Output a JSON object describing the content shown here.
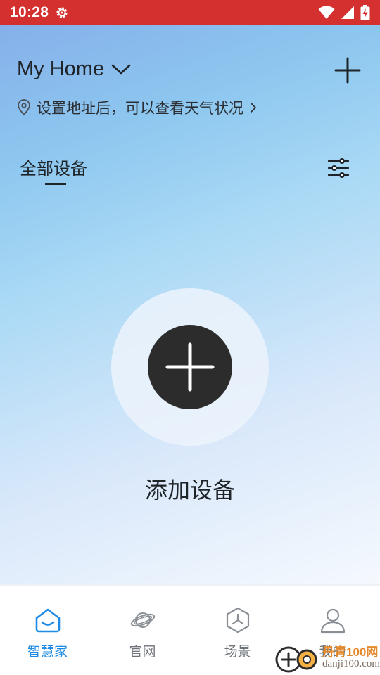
{
  "status_bar": {
    "time": "10:28"
  },
  "header": {
    "home_name": "My Home",
    "location_text": "设置地址后，可以查看天气状况"
  },
  "tabs": {
    "all_devices": "全部设备"
  },
  "main": {
    "add_device_label": "添加设备"
  },
  "bottom_nav": {
    "items": [
      {
        "label": "智慧家",
        "icon": "home-smile-icon",
        "active": true
      },
      {
        "label": "官网",
        "icon": "planet-icon",
        "active": false
      },
      {
        "label": "场景",
        "icon": "scene-hexagon-icon",
        "active": false
      },
      {
        "label": "我的",
        "icon": "person-icon",
        "active": false
      }
    ]
  },
  "watermark": {
    "brand": "丹青100网",
    "url": "danji100.com"
  },
  "colors": {
    "status_bar": "#d3302f",
    "accent": "#1e8ce6",
    "add_button": "#2c2c2c",
    "text_primary": "#1f2429",
    "nav_inactive": "#6f747a"
  }
}
